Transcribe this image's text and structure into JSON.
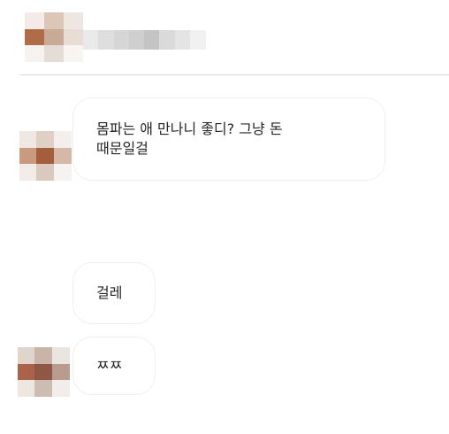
{
  "header": {
    "username": "",
    "avatar_colors": [
      "#f2ebe7",
      "#dcc6b8",
      "#eee6e1",
      "#b06c49",
      "#c8aa96",
      "#e8dcd5",
      "#f5f2ef",
      "#e6dcd6",
      "#f7f4f2"
    ],
    "name_blur_colors": [
      "#e9e9e9",
      "#dedede",
      "#d6d6d6",
      "#cfcfcf",
      "#c4c4c4",
      "#dadada",
      "#e4e4e4",
      "#f1f1f1"
    ]
  },
  "messages": [
    {
      "text": "몸파는 애 만나니 좋디? 그냥 돈\n때문일걸",
      "show_avatar": true
    },
    {
      "text": "걸레",
      "show_avatar": false
    },
    {
      "text": "ㅉㅉ",
      "show_avatar": true
    }
  ],
  "avatar_colors_1": [
    "#efe7e2",
    "#dfcfc5",
    "#f4efec",
    "#c99a80",
    "#a55e3c",
    "#d6b8a6",
    "#f2ece9",
    "#dac9bf",
    "#f6f2f0"
  ],
  "avatar_colors_2": [
    "#e0d4cc",
    "#c9b4a8",
    "#ece4de",
    "#a8634a",
    "#8f5744",
    "#b89b8e",
    "#efe6e0",
    "#cdbcb2",
    "#f2ede9"
  ],
  "colors": {
    "divider": "#dbdbdb",
    "bubble_border": "#efefef",
    "text": "#262626"
  }
}
